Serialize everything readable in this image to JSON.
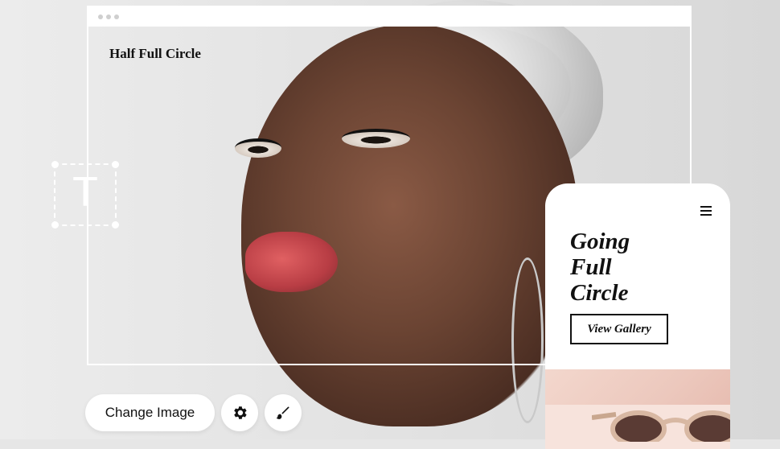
{
  "editor": {
    "site_title": "Half Full Circle",
    "text_tool_glyph": "T",
    "text_tool_icon": "text-tool-icon"
  },
  "mobile_preview": {
    "heading": "Going\nFull\nCircle",
    "gallery_button": "View Gallery",
    "menu_icon": "hamburger-menu-icon"
  },
  "toolbar": {
    "change_image_label": "Change Image",
    "settings_icon": "gear-icon",
    "style_icon": "paintbrush-icon"
  },
  "colors": {
    "frame": "#ffffff",
    "text": "#111111",
    "product_bg": "#ecc8bd"
  }
}
